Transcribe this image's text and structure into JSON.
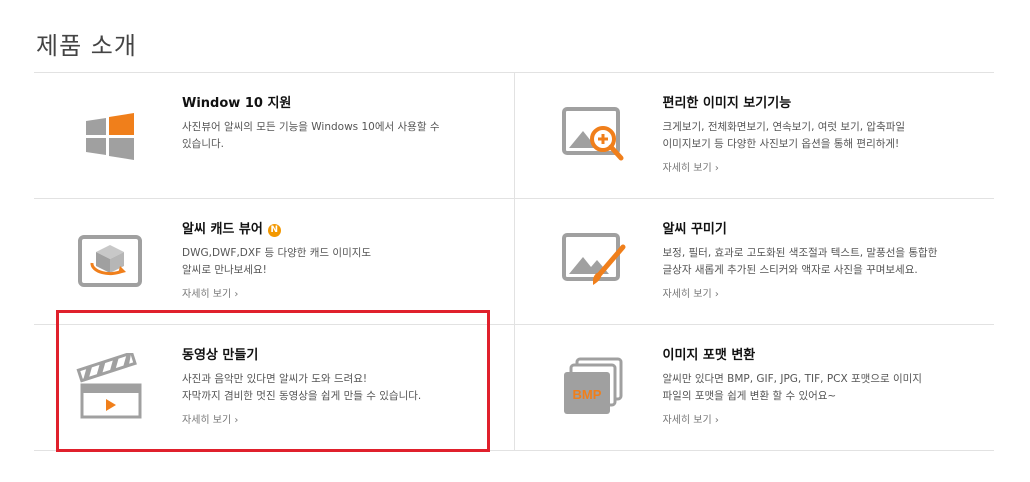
{
  "page_title": "제품 소개",
  "products": [
    {
      "id": "windows10",
      "title": "Window 10 지원",
      "badge": "",
      "desc_lines": [
        "사진뷰어 알씨의 모든 기능을 Windows 10에서 사용할 수",
        "있습니다."
      ],
      "more_label": ""
    },
    {
      "id": "viewer",
      "title": "편리한 이미지 보기기능",
      "badge": "",
      "desc_lines": [
        "크게보기, 전체화면보기, 연속보기, 여럿 보기, 압축파일",
        "이미지보기 등 다양한 사진보기 옵션을 통해 편리하게!"
      ],
      "more_label": "자세히 보기 ›"
    },
    {
      "id": "cad",
      "title": "알씨 캐드 뷰어",
      "badge": "N",
      "desc_lines": [
        "DWG,DWF,DXF 등 다양한 캐드 이미지도",
        "알씨로 만나보세요!"
      ],
      "more_label": "자세히 보기 ›"
    },
    {
      "id": "decorate",
      "title": "알씨 꾸미기",
      "badge": "",
      "desc_lines": [
        "보정, 필터, 효과로 고도화된 색조절과 텍스트, 말풍선을 통합한",
        "글상자 새롭게 추가된 스티커와 액자로 사진을 꾸며보세요."
      ],
      "more_label": "자세히 보기 ›"
    },
    {
      "id": "video",
      "title": "동영상 만들기",
      "badge": "",
      "desc_lines": [
        "사진과 음악만 있다면 알씨가 도와 드려요!",
        "자막까지 겸비한 멋진 동영상을 쉽게 만들 수 있습니다."
      ],
      "more_label": "자세히 보기 ›"
    },
    {
      "id": "convert",
      "title": "이미지 포맷 변환",
      "badge": "",
      "desc_lines": [
        "알씨만 있다면 BMP, GIF, JPG, TIF, PCX 포맷으로 이미지",
        "파일의 포맷을 쉽게 변환 할 수 있어요~"
      ],
      "more_label": "자세히 보기 ›"
    }
  ],
  "icons": {
    "bmp_text": "BMP"
  },
  "colors": {
    "accent": "#f07f1b",
    "icon_gray": "#a0a0a0",
    "highlight": "#e0202c"
  }
}
